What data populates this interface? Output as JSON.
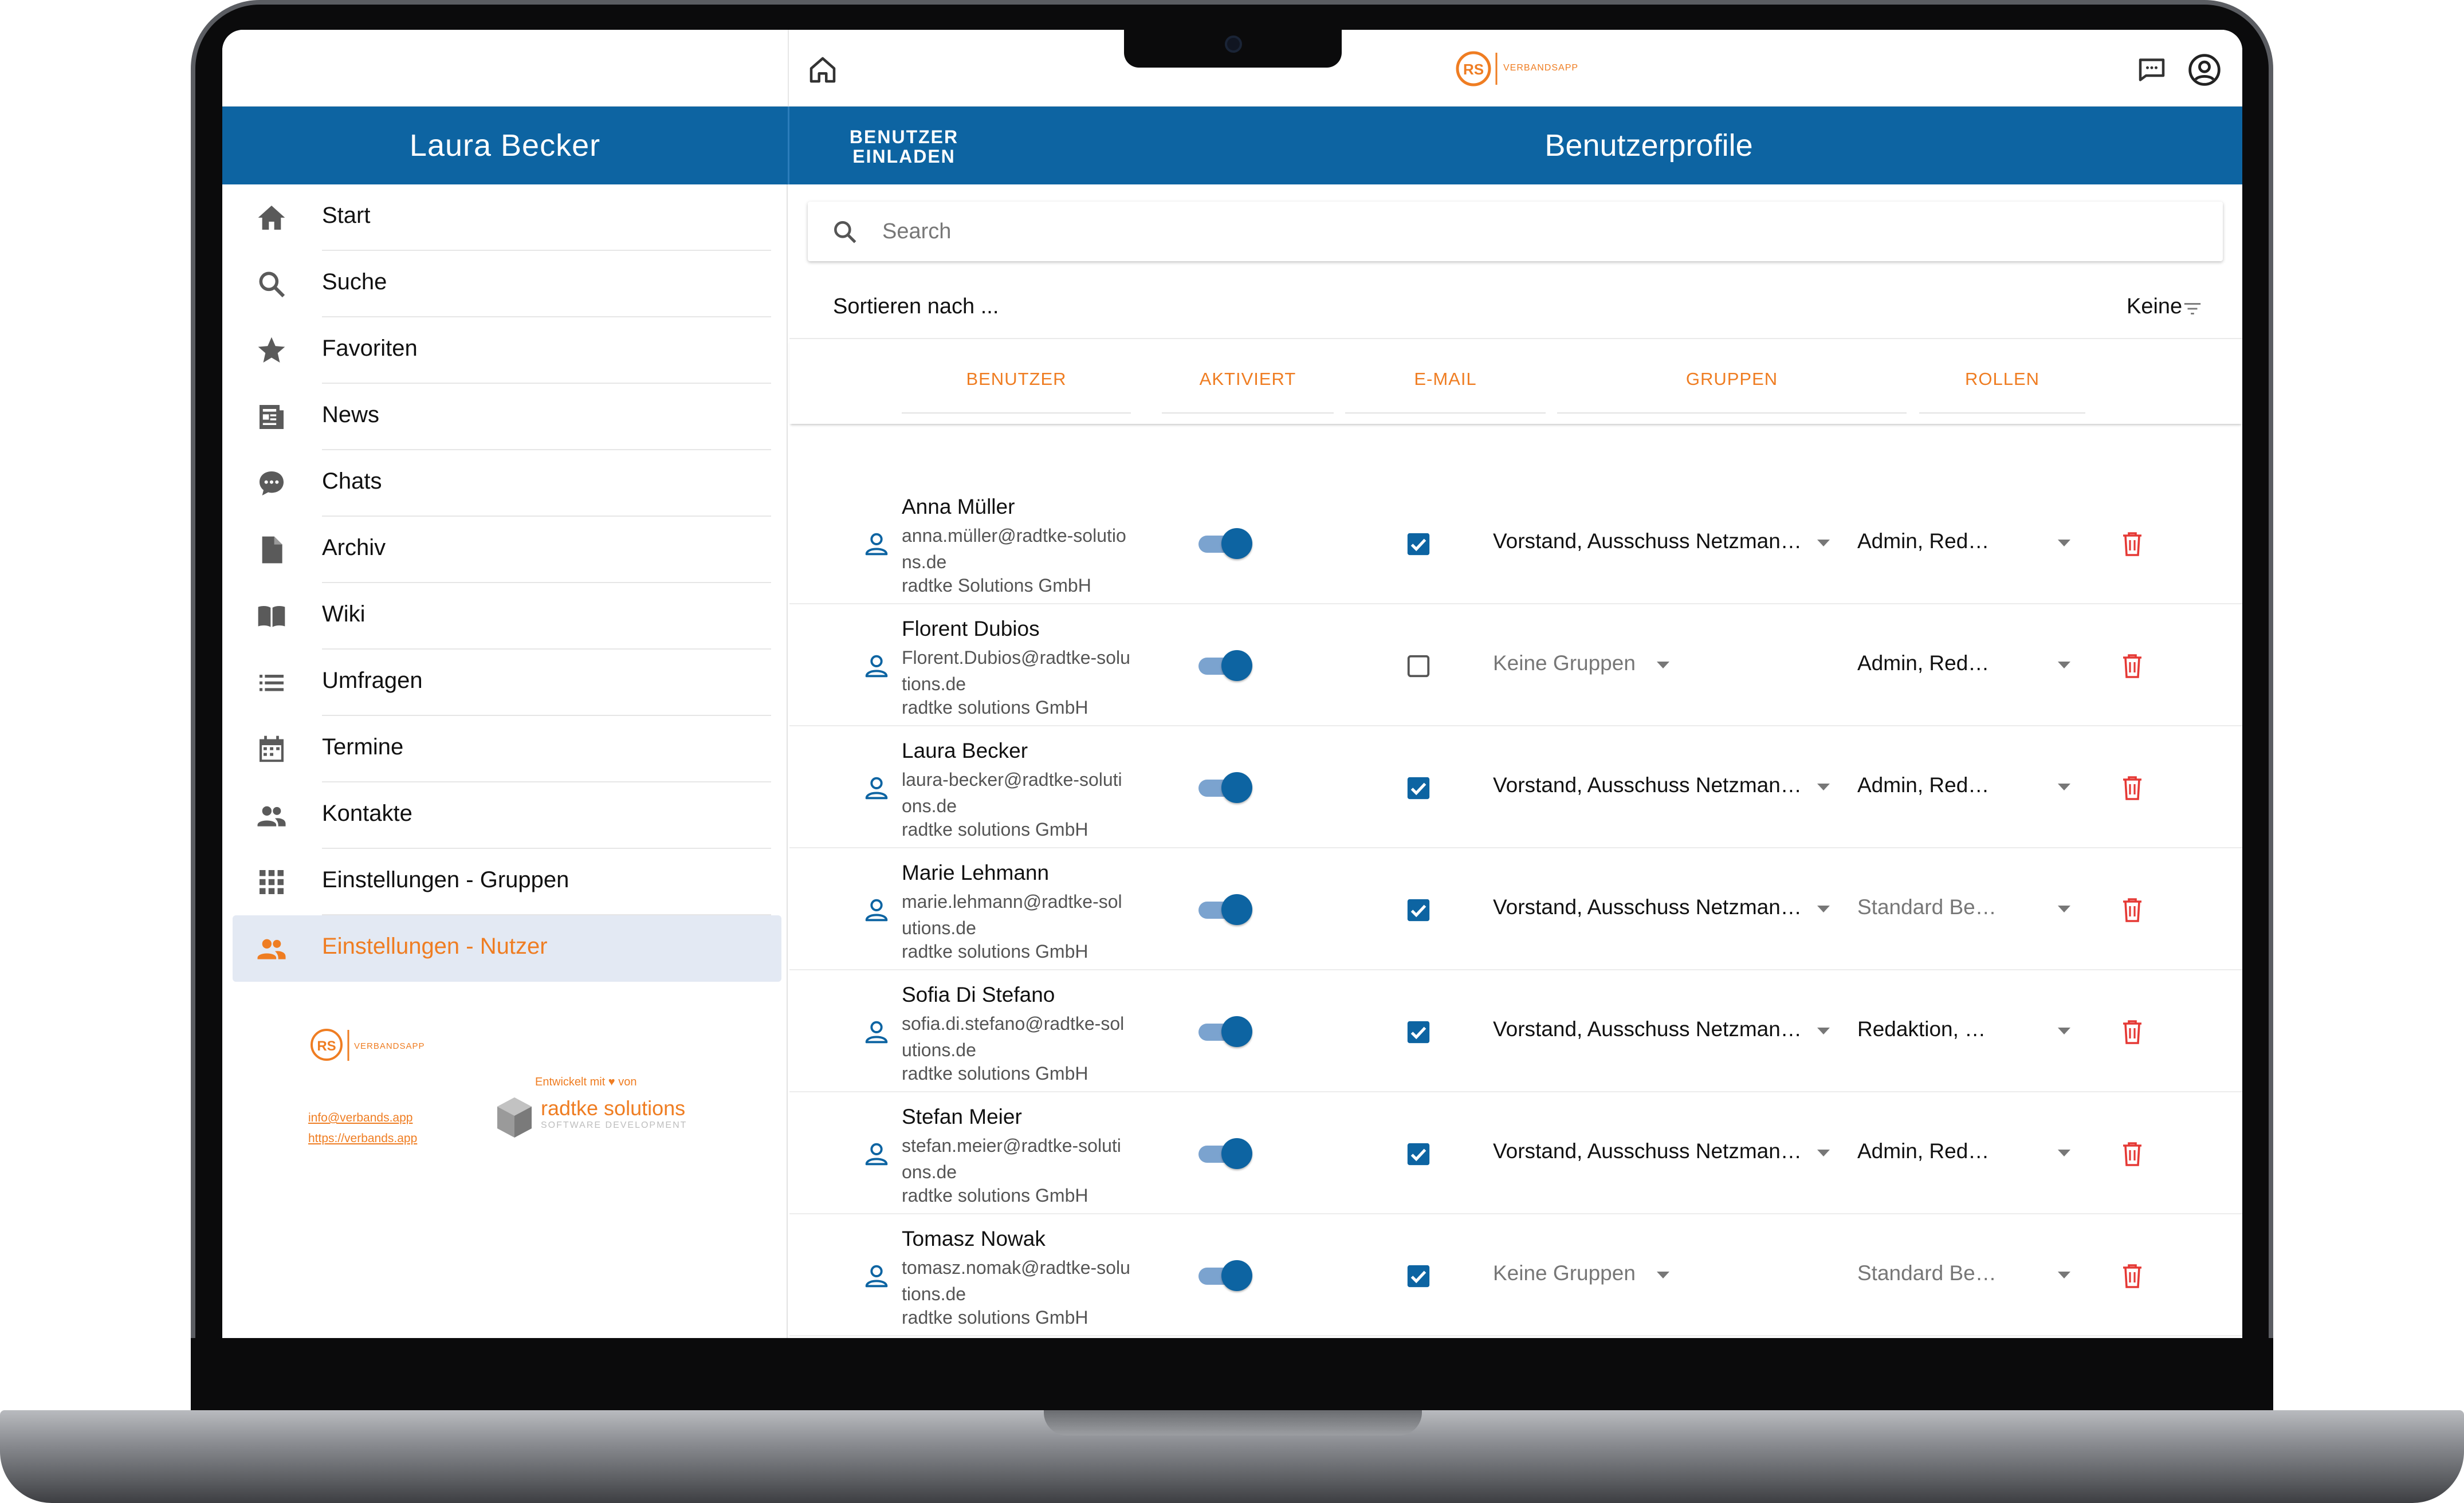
{
  "header": {
    "logo_text": "VERBANDSAPP",
    "logo_mark": "RS"
  },
  "sidebar": {
    "user_name": "Laura Becker",
    "items": [
      {
        "label": "Start",
        "icon": "home-icon"
      },
      {
        "label": "Suche",
        "icon": "search-icon"
      },
      {
        "label": "Favoriten",
        "icon": "star-icon"
      },
      {
        "label": "News",
        "icon": "newspaper-icon"
      },
      {
        "label": "Chats",
        "icon": "chat-bubble-icon"
      },
      {
        "label": "Archiv",
        "icon": "document-icon"
      },
      {
        "label": "Wiki",
        "icon": "book-icon"
      },
      {
        "label": "Umfragen",
        "icon": "list-icon"
      },
      {
        "label": "Termine",
        "icon": "calendar-icon"
      },
      {
        "label": "Kontakte",
        "icon": "contacts-icon"
      },
      {
        "label": "Einstellungen - Gruppen",
        "icon": "grid-icon"
      },
      {
        "label": "Einstellungen - Nutzer",
        "icon": "users-icon",
        "active": true
      }
    ],
    "footer": {
      "email": "info@verbands.app",
      "website": "https://verbands.app",
      "developed_by": "Entwickelt mit ♥ von",
      "company": "radtke solutions",
      "company_sub": "SOFTWARE DEVELOPMENT"
    }
  },
  "toolbar": {
    "invite_label": "BENUTZER EINLADEN",
    "page_title": "Benutzerprofile"
  },
  "search": {
    "placeholder": "Search",
    "value": ""
  },
  "sort": {
    "label": "Sortieren nach ...",
    "value": "Keine"
  },
  "table": {
    "columns": [
      "BENUTZER",
      "AKTIVIERT",
      "E-MAIL",
      "GRUPPEN",
      "ROLLEN"
    ],
    "rows": [
      {
        "name": "Anna Müller",
        "email": "anna.müller@radtke-solutions.de",
        "company": "radtke Solutions GmbH",
        "activated": true,
        "email_checked": true,
        "groups": "Vorstand, Ausschuss Netzman…",
        "groups_empty": false,
        "roles": "Admin, Red…",
        "roles_muted": false
      },
      {
        "name": "Florent Dubios",
        "email": "Florent.Dubios@radtke-solutions.de",
        "company": "radtke solutions GmbH",
        "activated": true,
        "email_checked": false,
        "groups": "Keine Gruppen",
        "groups_empty": true,
        "roles": "Admin, Red…",
        "roles_muted": false
      },
      {
        "name": "Laura Becker",
        "email": "laura-becker@radtke-solutions.de",
        "company": "radtke solutions GmbH",
        "activated": true,
        "email_checked": true,
        "groups": "Vorstand, Ausschuss Netzman…",
        "groups_empty": false,
        "roles": "Admin, Red…",
        "roles_muted": false
      },
      {
        "name": "Marie Lehmann",
        "email": "marie.lehmann@radtke-solutions.de",
        "company": "radtke solutions GmbH",
        "activated": true,
        "email_checked": true,
        "groups": "Vorstand, Ausschuss Netzman…",
        "groups_empty": false,
        "roles": "Standard Be…",
        "roles_muted": true
      },
      {
        "name": "Sofia Di Stefano",
        "email": "sofia.di.stefano@radtke-solutions.de",
        "company": "radtke solutions GmbH",
        "activated": true,
        "email_checked": true,
        "groups": "Vorstand, Ausschuss Netzman…",
        "groups_empty": false,
        "roles": "Redaktion, …",
        "roles_muted": false
      },
      {
        "name": "Stefan Meier",
        "email": "stefan.meier@radtke-solutions.de",
        "company": "radtke solutions GmbH",
        "activated": true,
        "email_checked": true,
        "groups": "Vorstand, Ausschuss Netzman…",
        "groups_empty": false,
        "roles": "Admin, Red…",
        "roles_muted": false
      },
      {
        "name": "Tomasz Nowak",
        "email": "tomasz.nomak@radtke-solutions.de",
        "company": "radtke solutions GmbH",
        "activated": true,
        "email_checked": true,
        "groups": "Keine Gruppen",
        "groups_empty": true,
        "roles": "Standard Be…",
        "roles_muted": true
      }
    ]
  },
  "colors": {
    "primary": "#0d64a2",
    "accent": "#ef7d22",
    "delete": "#e53935",
    "active_nav_bg": "#e3e9f3"
  }
}
